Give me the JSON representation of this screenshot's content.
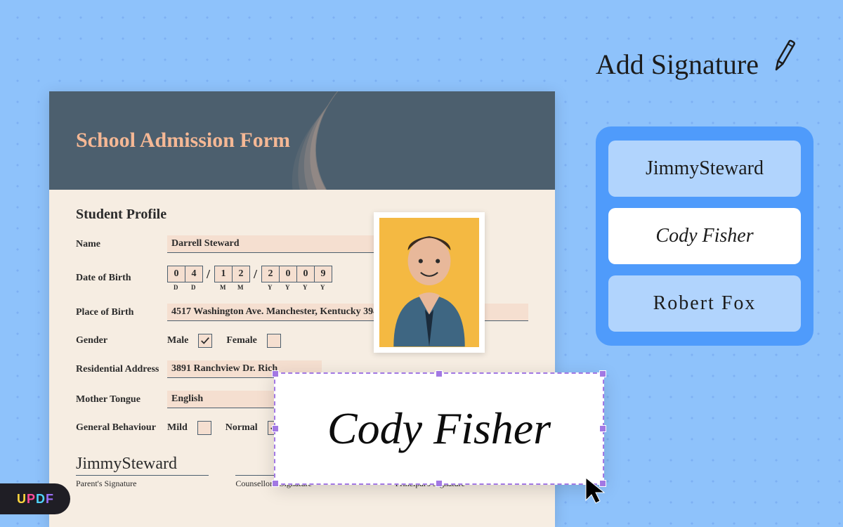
{
  "form": {
    "title": "School Admission Form",
    "section_title": "Student Profile",
    "labels": {
      "name": "Name",
      "dob": "Date of Birth",
      "pob": "Place of Birth",
      "gender": "Gender",
      "address": "Residential Address",
      "tongue": "Mother Tongue",
      "behaviour": "General Behaviour"
    },
    "values": {
      "name": "Darrell Steward",
      "pob": "4517 Washington Ave. Manchester, Kentucky 39495",
      "address": "3891 Ranchview Dr. Rich",
      "tongue": "English"
    },
    "dob": {
      "d1": "0",
      "d2": "4",
      "m1": "1",
      "m2": "2",
      "y1": "2",
      "y2": "0",
      "y3": "0",
      "y4": "9",
      "sub_d": "D",
      "sub_m": "M",
      "sub_y": "Y",
      "sep": "/"
    },
    "gender": {
      "male": "Male",
      "female": "Female",
      "selected": "male"
    },
    "behaviour": {
      "mild": "Mild",
      "normal": "Normal",
      "selected": "normal"
    },
    "signatures": {
      "parent_label": "Parent's Signature",
      "counsellor_label": "Counsellor's Signature",
      "principal_label": "Principal's Signature",
      "parent_value": "JimmySteward"
    }
  },
  "add_signature": {
    "title": "Add Signature",
    "options": [
      "JimmySteward",
      "Cody Fisher",
      "Robert Fox"
    ],
    "selected_index": 1
  },
  "stamp": {
    "text": "Cody Fisher"
  },
  "brand": {
    "u": "U",
    "p": "P",
    "d": "D",
    "f": "F"
  }
}
